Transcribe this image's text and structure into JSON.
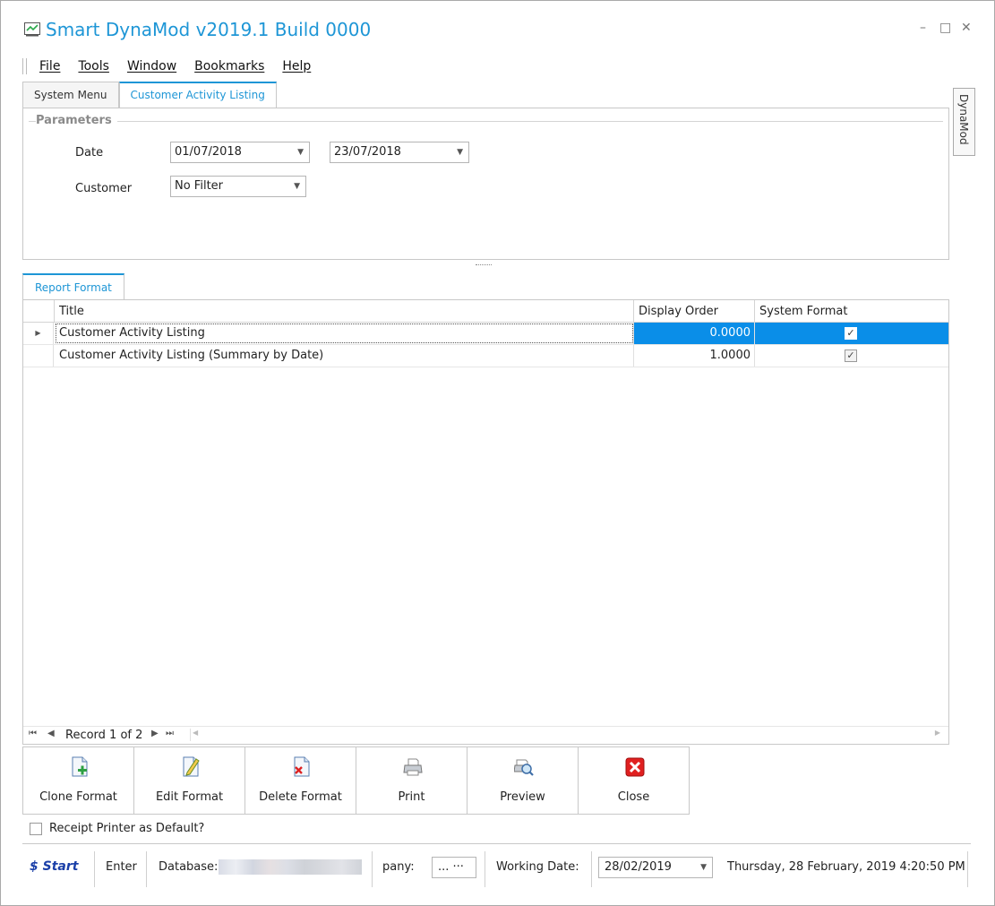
{
  "window": {
    "title": "Smart DynaMod v2019.1 Build 0000",
    "controls": {
      "minimize": "–",
      "maximize": "□",
      "close": "✕"
    }
  },
  "menu": {
    "items": [
      "File",
      "Tools",
      "Window",
      "Bookmarks",
      "Help"
    ]
  },
  "doc_tabs": [
    {
      "label": "System Menu",
      "active": false
    },
    {
      "label": "Customer Activity Listing",
      "active": true
    }
  ],
  "side_tab": {
    "label": "DynaMod"
  },
  "parameters": {
    "legend": "Parameters",
    "date_label": "Date",
    "date_from": "01/07/2018",
    "date_to": "23/07/2018",
    "customer_label": "Customer",
    "customer_value": "No Filter"
  },
  "report_format": {
    "tab_label": "Report Format",
    "columns": [
      "Title",
      "Display Order",
      "System Format"
    ],
    "rows": [
      {
        "title": "Customer Activity Listing",
        "display_order": "0.0000",
        "system_format": true,
        "selected": true
      },
      {
        "title": "Customer Activity Listing (Summary by Date)",
        "display_order": "1.0000",
        "system_format": true,
        "selected": false
      }
    ],
    "navigator_text": "Record 1 of 2"
  },
  "buttons": [
    {
      "label": "Clone Format",
      "icon": "clone-format-icon"
    },
    {
      "label": "Edit Format",
      "icon": "edit-format-icon"
    },
    {
      "label": "Delete Format",
      "icon": "delete-format-icon"
    },
    {
      "label": "Print",
      "icon": "printer-icon"
    },
    {
      "label": "Preview",
      "icon": "preview-icon"
    },
    {
      "label": "Close",
      "icon": "close-red-icon"
    }
  ],
  "receipt_checkbox": {
    "label": "Receipt Printer as Default?",
    "checked": false
  },
  "statusbar": {
    "start_label": "Start",
    "enter_label": "Enter",
    "database_label": "Database:",
    "company_label": "pany:",
    "company_value": "... ···",
    "working_date_label": "Working Date:",
    "working_date_value": "28/02/2019",
    "datetime": "Thursday, 28 February, 2019 4:20:50 PM"
  },
  "colors": {
    "accent": "#1e96d6",
    "selection": "#0a8ee8",
    "close_red": "#e02020"
  }
}
